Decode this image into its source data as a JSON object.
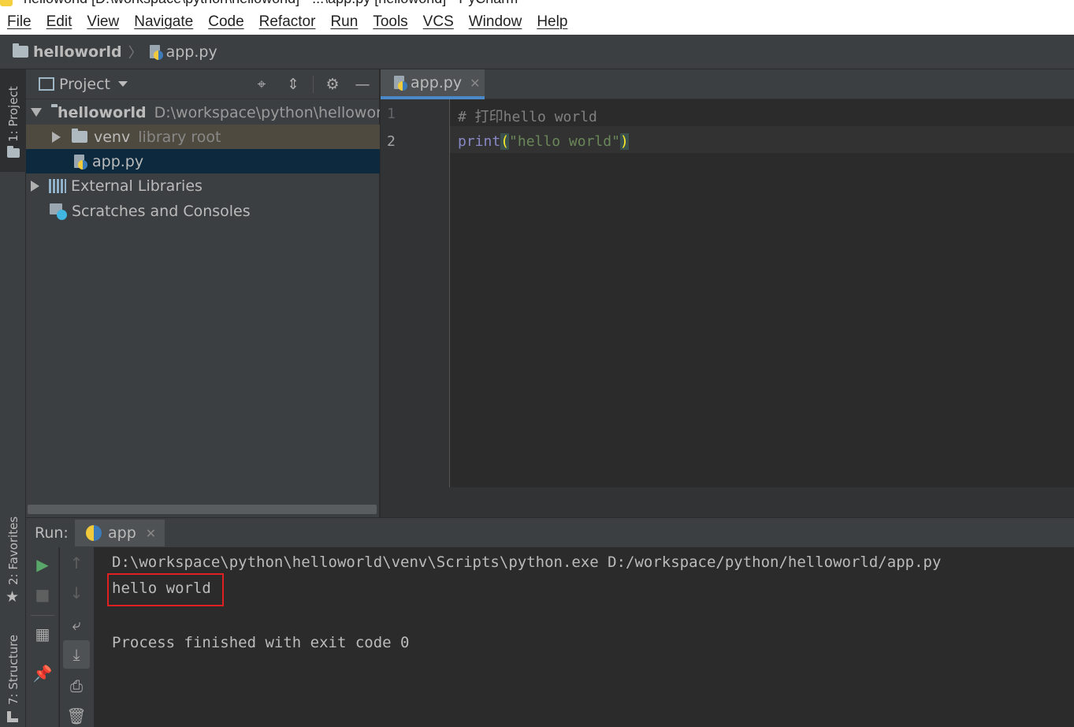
{
  "window": {
    "title": "helloworld [D:\\workspace\\python\\helloworld] - ...\\app.py [helloworld] - PyCharm"
  },
  "menu": [
    "File",
    "Edit",
    "View",
    "Navigate",
    "Code",
    "Refactor",
    "Run",
    "Tools",
    "VCS",
    "Window",
    "Help"
  ],
  "breadcrumb": {
    "project": "helloworld",
    "file": "app.py"
  },
  "left_stripe": {
    "project_tab": "1: Project",
    "favorites_tab": "2: Favorites",
    "structure_tab": "7: Structure"
  },
  "project_panel": {
    "title": "Project",
    "tree": {
      "root_name": "helloworld",
      "root_path": "D:\\workspace\\python\\helloworld",
      "venv_name": "venv",
      "venv_hint": "library root",
      "file_name": "app.py",
      "ext_libs": "External Libraries",
      "scratches": "Scratches and Consoles"
    }
  },
  "editor": {
    "tab_label": "app.py",
    "line_numbers": [
      "1",
      "2"
    ],
    "lines": {
      "l1_comment": "# 打印hello world",
      "l2_func": "print",
      "l2_open": "(",
      "l2_string": "\"hello world\"",
      "l2_close": ")"
    }
  },
  "run_panel": {
    "label": "Run:",
    "tab_label": "app",
    "console": {
      "command": "D:\\workspace\\python\\helloworld\\venv\\Scripts\\python.exe D:/workspace/python/helloworld/app.py",
      "output": "hello world",
      "exit": "Process finished with exit code 0"
    }
  },
  "colors": {
    "keyword_func": "#8888c6",
    "string": "#6a8759",
    "comment": "#808080",
    "bracket_match": "#ffef28",
    "selection": "#0d293e",
    "run_green": "#59a869",
    "highlight_box": "#e02020"
  }
}
